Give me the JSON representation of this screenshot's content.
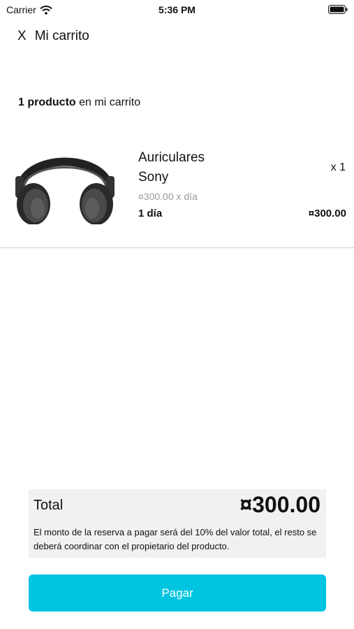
{
  "status_bar": {
    "carrier": "Carrier",
    "time": "5:36 PM"
  },
  "header": {
    "close_label": "X",
    "title": "Mi carrito"
  },
  "summary": {
    "count_bold": "1 producto",
    "suffix": "en mi carrito"
  },
  "cart": {
    "items": [
      {
        "name_line1": "Auriculares",
        "name_line2": "Sony",
        "quantity": "x 1",
        "unit_price": "¤300.00 x día",
        "days": "1  día",
        "line_total": "¤300.00",
        "image_icon": "headphones-icon"
      }
    ]
  },
  "totals": {
    "label": "Total",
    "value": "¤300.00",
    "note": "El monto de la reserva a pagar será del 10% del valor total, el resto se deberá coordinar con el propietario del producto."
  },
  "actions": {
    "pay_label": "Pagar"
  },
  "colors": {
    "accent": "#00c4e0",
    "total_box_bg": "#f1f1f1",
    "muted_text": "#9a9a9a"
  }
}
